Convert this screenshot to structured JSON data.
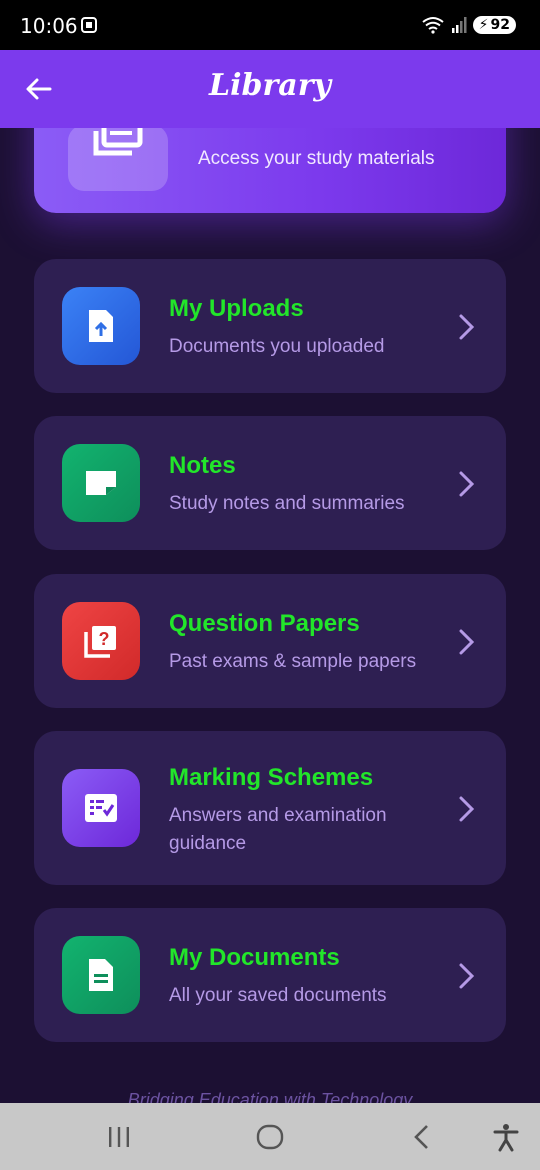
{
  "status": {
    "time": "10:06",
    "battery": "92"
  },
  "app_bar": {
    "title": "Library"
  },
  "hero": {
    "subtitle": "Access your study materials"
  },
  "items": [
    {
      "title": "My Uploads",
      "subtitle": "Documents you uploaded",
      "color": "#2f6fe6",
      "icon": "upload-file-icon"
    },
    {
      "title": "Notes",
      "subtitle": "Study notes and summaries",
      "color": "#10a46a",
      "icon": "note-icon"
    },
    {
      "title": "Question Papers",
      "subtitle": "Past exams & sample papers",
      "color": "#e0322f",
      "icon": "quiz-icon"
    },
    {
      "title": "Marking Schemes",
      "subtitle": "Answers and examination guidance",
      "color": "#7c3aed",
      "icon": "checklist-icon"
    },
    {
      "title": "My Documents",
      "subtitle": "All your saved documents",
      "color": "#10a46a",
      "icon": "document-icon"
    }
  ],
  "footer": {
    "tagline": "Bridging Education with Technology"
  },
  "colors": {
    "accent": "#7c3aed",
    "title_green": "#22e62a",
    "card_bg": "#2e1f52"
  }
}
